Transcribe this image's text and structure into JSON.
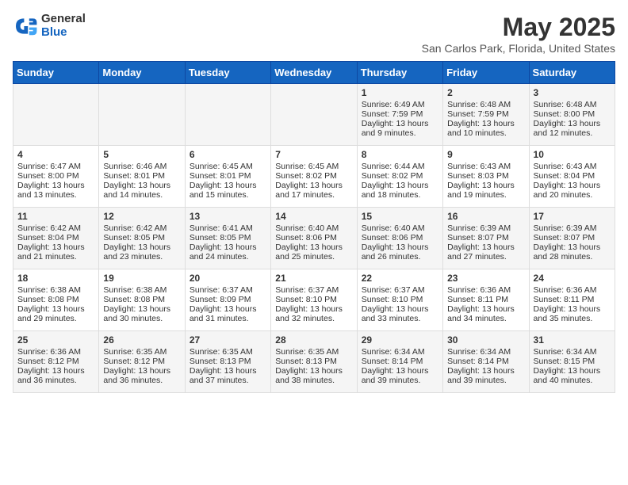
{
  "header": {
    "logo_general": "General",
    "logo_blue": "Blue",
    "title": "May 2025",
    "subtitle": "San Carlos Park, Florida, United States"
  },
  "days_of_week": [
    "Sunday",
    "Monday",
    "Tuesday",
    "Wednesday",
    "Thursday",
    "Friday",
    "Saturday"
  ],
  "weeks": [
    [
      {
        "day": "",
        "content": ""
      },
      {
        "day": "",
        "content": ""
      },
      {
        "day": "",
        "content": ""
      },
      {
        "day": "",
        "content": ""
      },
      {
        "day": "1",
        "content": "Sunrise: 6:49 AM\nSunset: 7:59 PM\nDaylight: 13 hours\nand 9 minutes."
      },
      {
        "day": "2",
        "content": "Sunrise: 6:48 AM\nSunset: 7:59 PM\nDaylight: 13 hours\nand 10 minutes."
      },
      {
        "day": "3",
        "content": "Sunrise: 6:48 AM\nSunset: 8:00 PM\nDaylight: 13 hours\nand 12 minutes."
      }
    ],
    [
      {
        "day": "4",
        "content": "Sunrise: 6:47 AM\nSunset: 8:00 PM\nDaylight: 13 hours\nand 13 minutes."
      },
      {
        "day": "5",
        "content": "Sunrise: 6:46 AM\nSunset: 8:01 PM\nDaylight: 13 hours\nand 14 minutes."
      },
      {
        "day": "6",
        "content": "Sunrise: 6:45 AM\nSunset: 8:01 PM\nDaylight: 13 hours\nand 15 minutes."
      },
      {
        "day": "7",
        "content": "Sunrise: 6:45 AM\nSunset: 8:02 PM\nDaylight: 13 hours\nand 17 minutes."
      },
      {
        "day": "8",
        "content": "Sunrise: 6:44 AM\nSunset: 8:02 PM\nDaylight: 13 hours\nand 18 minutes."
      },
      {
        "day": "9",
        "content": "Sunrise: 6:43 AM\nSunset: 8:03 PM\nDaylight: 13 hours\nand 19 minutes."
      },
      {
        "day": "10",
        "content": "Sunrise: 6:43 AM\nSunset: 8:04 PM\nDaylight: 13 hours\nand 20 minutes."
      }
    ],
    [
      {
        "day": "11",
        "content": "Sunrise: 6:42 AM\nSunset: 8:04 PM\nDaylight: 13 hours\nand 21 minutes."
      },
      {
        "day": "12",
        "content": "Sunrise: 6:42 AM\nSunset: 8:05 PM\nDaylight: 13 hours\nand 23 minutes."
      },
      {
        "day": "13",
        "content": "Sunrise: 6:41 AM\nSunset: 8:05 PM\nDaylight: 13 hours\nand 24 minutes."
      },
      {
        "day": "14",
        "content": "Sunrise: 6:40 AM\nSunset: 8:06 PM\nDaylight: 13 hours\nand 25 minutes."
      },
      {
        "day": "15",
        "content": "Sunrise: 6:40 AM\nSunset: 8:06 PM\nDaylight: 13 hours\nand 26 minutes."
      },
      {
        "day": "16",
        "content": "Sunrise: 6:39 AM\nSunset: 8:07 PM\nDaylight: 13 hours\nand 27 minutes."
      },
      {
        "day": "17",
        "content": "Sunrise: 6:39 AM\nSunset: 8:07 PM\nDaylight: 13 hours\nand 28 minutes."
      }
    ],
    [
      {
        "day": "18",
        "content": "Sunrise: 6:38 AM\nSunset: 8:08 PM\nDaylight: 13 hours\nand 29 minutes."
      },
      {
        "day": "19",
        "content": "Sunrise: 6:38 AM\nSunset: 8:08 PM\nDaylight: 13 hours\nand 30 minutes."
      },
      {
        "day": "20",
        "content": "Sunrise: 6:37 AM\nSunset: 8:09 PM\nDaylight: 13 hours\nand 31 minutes."
      },
      {
        "day": "21",
        "content": "Sunrise: 6:37 AM\nSunset: 8:10 PM\nDaylight: 13 hours\nand 32 minutes."
      },
      {
        "day": "22",
        "content": "Sunrise: 6:37 AM\nSunset: 8:10 PM\nDaylight: 13 hours\nand 33 minutes."
      },
      {
        "day": "23",
        "content": "Sunrise: 6:36 AM\nSunset: 8:11 PM\nDaylight: 13 hours\nand 34 minutes."
      },
      {
        "day": "24",
        "content": "Sunrise: 6:36 AM\nSunset: 8:11 PM\nDaylight: 13 hours\nand 35 minutes."
      }
    ],
    [
      {
        "day": "25",
        "content": "Sunrise: 6:36 AM\nSunset: 8:12 PM\nDaylight: 13 hours\nand 36 minutes."
      },
      {
        "day": "26",
        "content": "Sunrise: 6:35 AM\nSunset: 8:12 PM\nDaylight: 13 hours\nand 36 minutes."
      },
      {
        "day": "27",
        "content": "Sunrise: 6:35 AM\nSunset: 8:13 PM\nDaylight: 13 hours\nand 37 minutes."
      },
      {
        "day": "28",
        "content": "Sunrise: 6:35 AM\nSunset: 8:13 PM\nDaylight: 13 hours\nand 38 minutes."
      },
      {
        "day": "29",
        "content": "Sunrise: 6:34 AM\nSunset: 8:14 PM\nDaylight: 13 hours\nand 39 minutes."
      },
      {
        "day": "30",
        "content": "Sunrise: 6:34 AM\nSunset: 8:14 PM\nDaylight: 13 hours\nand 39 minutes."
      },
      {
        "day": "31",
        "content": "Sunrise: 6:34 AM\nSunset: 8:15 PM\nDaylight: 13 hours\nand 40 minutes."
      }
    ]
  ]
}
